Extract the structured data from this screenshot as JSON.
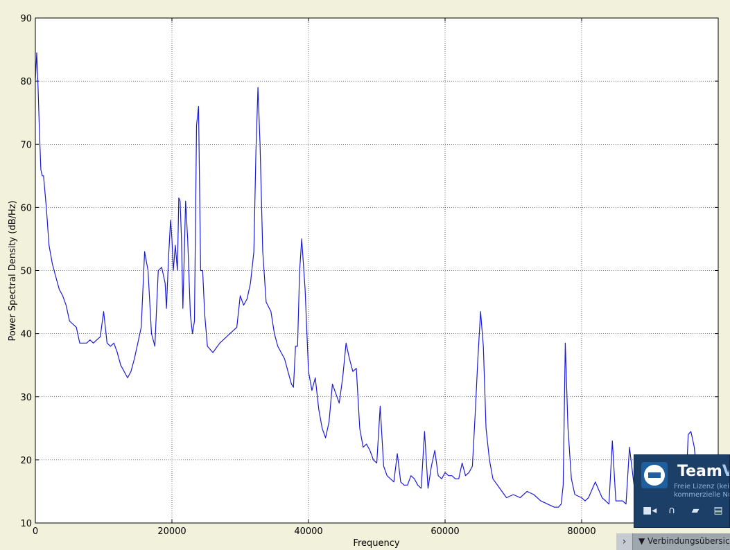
{
  "chart_data": {
    "type": "line",
    "title": "",
    "xlabel": "Frequency",
    "ylabel": "Power Spectral Density (dB/Hz)",
    "xlim": [
      0,
      100000
    ],
    "ylim": [
      10,
      90
    ],
    "xticks": [
      0,
      20000,
      40000,
      60000,
      80000
    ],
    "yticks": [
      10,
      20,
      30,
      40,
      50,
      60,
      70,
      80,
      90
    ],
    "grid": true,
    "line_color": "#1a1ad6",
    "x": [
      0,
      200,
      400,
      600,
      800,
      1000,
      1200,
      1600,
      2000,
      2500,
      3000,
      3500,
      4000,
      4500,
      5000,
      5500,
      6000,
      6500,
      7000,
      7500,
      8000,
      8500,
      9000,
      9500,
      10000,
      10500,
      11000,
      11500,
      12000,
      12500,
      13000,
      13500,
      14000,
      14500,
      15000,
      15500,
      16000,
      16500,
      17000,
      17500,
      18000,
      18500,
      19000,
      19200,
      19500,
      19800,
      20000,
      20200,
      20500,
      20800,
      21000,
      21200,
      21400,
      21600,
      21800,
      22000,
      22300,
      22700,
      23000,
      23300,
      23600,
      23900,
      24200,
      24500,
      24800,
      25200,
      26000,
      27000,
      28000,
      28500,
      29000,
      29500,
      30000,
      30500,
      31000,
      31500,
      32000,
      32300,
      32600,
      32900,
      33300,
      33800,
      34500,
      35000,
      35500,
      36000,
      36500,
      37000,
      37500,
      37800,
      38100,
      38400,
      38700,
      39000,
      39500,
      40000,
      40500,
      41000,
      41500,
      42000,
      42500,
      43000,
      43500,
      44000,
      44500,
      45000,
      45500,
      46000,
      46500,
      47000,
      47500,
      48000,
      48500,
      49000,
      49500,
      50000,
      50500,
      51000,
      51500,
      52000,
      52500,
      53000,
      53500,
      54000,
      54500,
      55000,
      55500,
      56000,
      56500,
      57000,
      57500,
      58000,
      58500,
      59000,
      59500,
      60000,
      60500,
      61000,
      61500,
      62000,
      62500,
      63000,
      63500,
      64000,
      64400,
      64800,
      65200,
      65600,
      66000,
      66500,
      67000,
      68000,
      69000,
      70000,
      71000,
      72000,
      73000,
      74000,
      75000,
      76000,
      76600,
      77000,
      77300,
      77600,
      78000,
      78500,
      79000,
      80000,
      80500,
      81000,
      82000,
      83000,
      83500,
      84000,
      84500,
      85000,
      86000,
      86500,
      87000,
      88000,
      89000,
      90000,
      91000,
      92000,
      93000,
      94000,
      95000,
      95300,
      95600,
      96000,
      96500,
      97000,
      98000,
      99000,
      100000
    ],
    "y": [
      80,
      84.5,
      79,
      72,
      66,
      65,
      65,
      60,
      54,
      51,
      49,
      47,
      46,
      44.5,
      42,
      41.5,
      41,
      38.5,
      38.5,
      38.5,
      39,
      38.5,
      39,
      39.5,
      43.5,
      38.5,
      38,
      38.5,
      37,
      35,
      34,
      33,
      34,
      36,
      38.5,
      41,
      53,
      50,
      40,
      38,
      50,
      50.5,
      48,
      44,
      52,
      58,
      55,
      50,
      54,
      50,
      61.5,
      61,
      55,
      44,
      52,
      61,
      55,
      43,
      40,
      42,
      73,
      76,
      50,
      50,
      43,
      38,
      37,
      38.5,
      39.5,
      40,
      40.5,
      41,
      46,
      44.5,
      45.5,
      48,
      53,
      69,
      79,
      70,
      53,
      45,
      43.5,
      40,
      38,
      37,
      36,
      34,
      32,
      31.5,
      38,
      38,
      50,
      55,
      47,
      34,
      31,
      33,
      28,
      25,
      23.5,
      26,
      32,
      30.5,
      29,
      33,
      38.5,
      36,
      34,
      34.5,
      25,
      22,
      22.5,
      21.5,
      20,
      19.5,
      28.5,
      19,
      17.5,
      17,
      16.5,
      21,
      16.5,
      16,
      16,
      17.5,
      17,
      16,
      15.5,
      24.5,
      15.5,
      19,
      21.5,
      17.5,
      17,
      18,
      17.5,
      17.5,
      17,
      17,
      19.5,
      17.5,
      18,
      19,
      27,
      36,
      43.5,
      38,
      25,
      20,
      17,
      15.5,
      14,
      14.5,
      14,
      15,
      14.5,
      13.5,
      13,
      12.5,
      12.5,
      13,
      16,
      38.5,
      25,
      17,
      14.5,
      14,
      13.5,
      14,
      16.5,
      14,
      13.5,
      13,
      23,
      13.5,
      13.5,
      13,
      22,
      13,
      13.5,
      14,
      13,
      13.5,
      13,
      14,
      15,
      16,
      24,
      24.5,
      22,
      16,
      14.5,
      14,
      13.5,
      14.5
    ]
  },
  "teamviewer": {
    "name_bold": "Team",
    "name_light": "Vi",
    "license_line1": "Freie Lizenz (kei",
    "license_line2": "kommerzielle Nu",
    "bar_arrow": "›",
    "bar_label": "▼ Verbindungsübersic"
  }
}
